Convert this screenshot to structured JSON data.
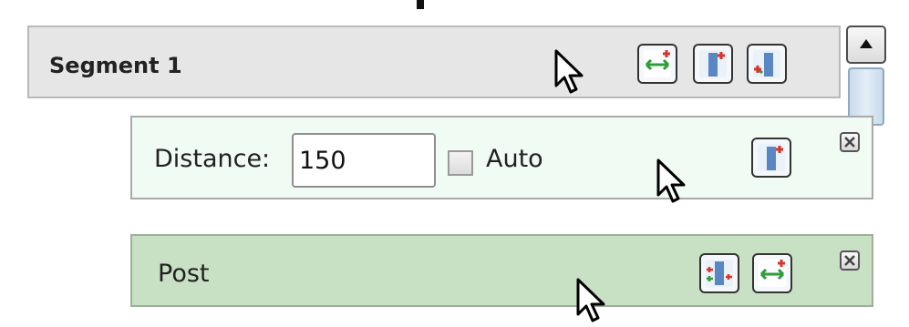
{
  "segment": {
    "title": "Segment 1",
    "buttons": [
      {
        "icon": "spread-horizontal-icon"
      },
      {
        "icon": "insert-post-icon"
      },
      {
        "icon": "insert-post-before-icon"
      }
    ]
  },
  "scrollbar": {
    "up_icon": "arrow-up-icon"
  },
  "distance_panel": {
    "label": "Distance:",
    "value": "150",
    "auto_label": "Auto",
    "auto_checked": false,
    "button_icon": "insert-post-icon",
    "close_icon": "close-icon"
  },
  "post_panel": {
    "label": "Post",
    "buttons": [
      {
        "icon": "split-post-icon"
      },
      {
        "icon": "spread-horizontal-icon"
      }
    ],
    "close_icon": "close-icon"
  },
  "colors": {
    "segment_bg": "#e6e6e6",
    "distance_bg": "#f0fbf4",
    "post_bg": "#c8e0c4",
    "arrow_green": "#2e9e3a",
    "plus_red": "#d9342b",
    "post_blue": "#5a86c4"
  }
}
